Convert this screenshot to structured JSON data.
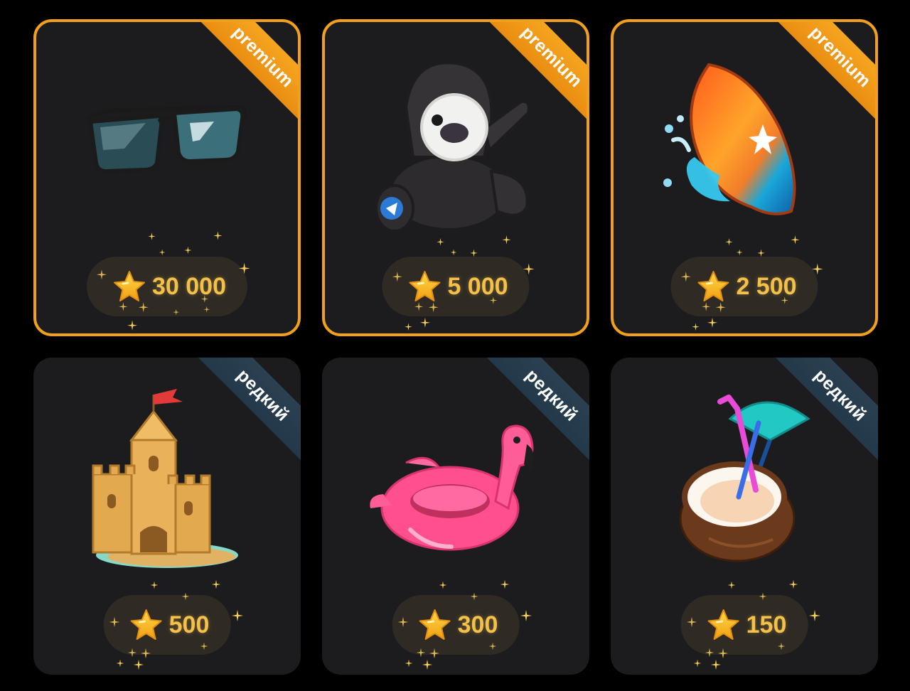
{
  "colors": {
    "card_bg": "#1c1c1e",
    "premium_accent": "#f0a01c",
    "rare_ribbon": "#273d4e",
    "price_text": "#f3c04a",
    "page_bg": "#000000"
  },
  "gifts": [
    {
      "rarity": "premium",
      "badge": "premium",
      "item_icon": "sunglasses-icon",
      "price": "30 000",
      "currency_icon": "star-icon"
    },
    {
      "rarity": "premium",
      "badge": "premium",
      "item_icon": "plush-bear-icon",
      "price": "5 000",
      "currency_icon": "star-icon"
    },
    {
      "rarity": "premium",
      "badge": "premium",
      "item_icon": "surfboard-icon",
      "price": "2 500",
      "currency_icon": "star-icon"
    },
    {
      "rarity": "rare",
      "badge": "редкий",
      "item_icon": "sandcastle-icon",
      "price": "500",
      "currency_icon": "star-icon"
    },
    {
      "rarity": "rare",
      "badge": "редкий",
      "item_icon": "flamingo-float-icon",
      "price": "300",
      "currency_icon": "star-icon"
    },
    {
      "rarity": "rare",
      "badge": "редкий",
      "item_icon": "coconut-cocktail-icon",
      "price": "150",
      "currency_icon": "star-icon"
    }
  ]
}
